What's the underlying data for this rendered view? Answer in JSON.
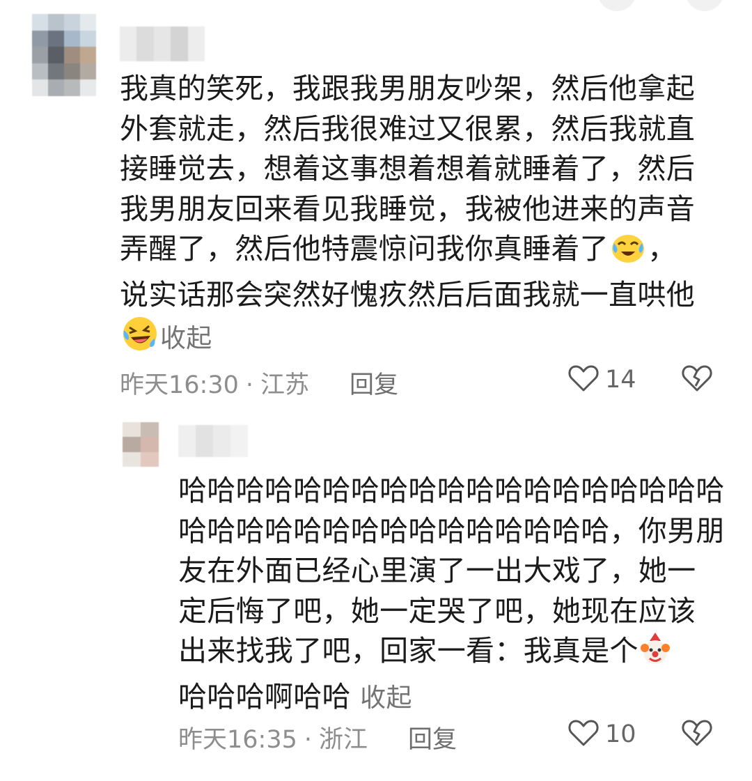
{
  "comments": [
    {
      "lines": [
        "我真的笑死，我跟我男朋友吵架，然后他拿起",
        "外套就走，然后我很难过又很累，然后我就直",
        "接睡觉去，想着这事想着想着就睡着了，然后",
        "我男朋友回来看见我睡觉，我被他进来的声音",
        "弄醒了，然后他特震惊问我你真睡着了",
        "，",
        "说实话那会突然好愧疚然后后面我就一直哄他"
      ],
      "line6_emoji": "crying-laughing-tears-emoji",
      "last_emoji": "rolling-laughing-emoji",
      "collapse_label": "收起",
      "time": "昨天16:30",
      "separator": "·",
      "location": "江苏",
      "reply_label": "回复",
      "likes": "14"
    },
    {
      "lines": [
        "哈哈哈哈哈哈哈哈哈哈哈哈哈哈哈哈哈哈哈",
        "哈哈哈哈哈哈哈哈哈哈哈哈哈哈哈，你男朋",
        "友在外面已经心里演了一出大戏了，她一",
        "定后悔了吧，她一定哭了吧，她现在应该",
        "出来找我了吧，回家一看：我真是个",
        "哈哈哈啊哈哈"
      ],
      "line5_emoji": "clown-emoji",
      "collapse_label": "收起",
      "time": "昨天16:35",
      "separator": "·",
      "location": "浙江",
      "reply_label": "回复",
      "likes": "10"
    }
  ],
  "colors": {
    "meta_text": "#8d8d8d",
    "body_text": "#1b1b1b",
    "collapse_text": "#747474",
    "icon_stroke": "#555555",
    "emoji_face": "#ffd23f"
  }
}
